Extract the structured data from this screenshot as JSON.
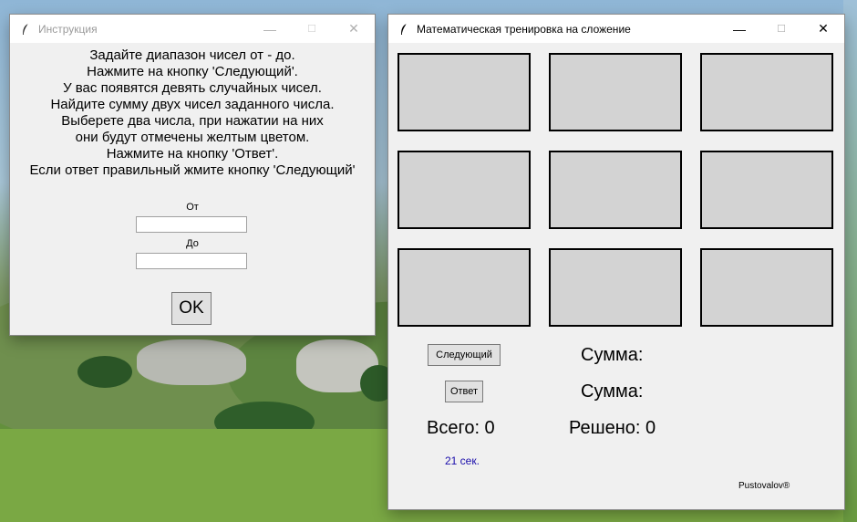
{
  "instruction_window": {
    "title": "Инструкция",
    "lines": [
      "Задайте диапазон чисел от - до.",
      "Нажмите на кнопку 'Следующий'.",
      "У вас появятся девять случайных чисел.",
      "Найдите сумму двух чисел заданного числа.",
      "Выберете два числа, при нажатии на них",
      "они будут отмечены желтым цветом.",
      "Нажмите на кнопку 'Ответ'.",
      "Если ответ правильный жмите кнопку 'Следующий'"
    ],
    "from_label": "От",
    "from_value": "",
    "to_label": "До",
    "to_value": "",
    "ok_label": "OK"
  },
  "training_window": {
    "title": "Математическая тренировка на сложение",
    "cells": [
      "",
      "",
      "",
      "",
      "",
      "",
      "",
      "",
      ""
    ],
    "next_label": "Следующий",
    "answer_label": "Ответ",
    "sum_label_1": "Сумма:",
    "sum_label_2": "Сумма:",
    "total_label": "Всего: 0",
    "solved_label": "Решено: 0",
    "timer": "21 сек.",
    "credit": "Pustovalov®"
  },
  "window_controls": {
    "minimize": "—",
    "maximize": "☐",
    "close": "✕"
  }
}
